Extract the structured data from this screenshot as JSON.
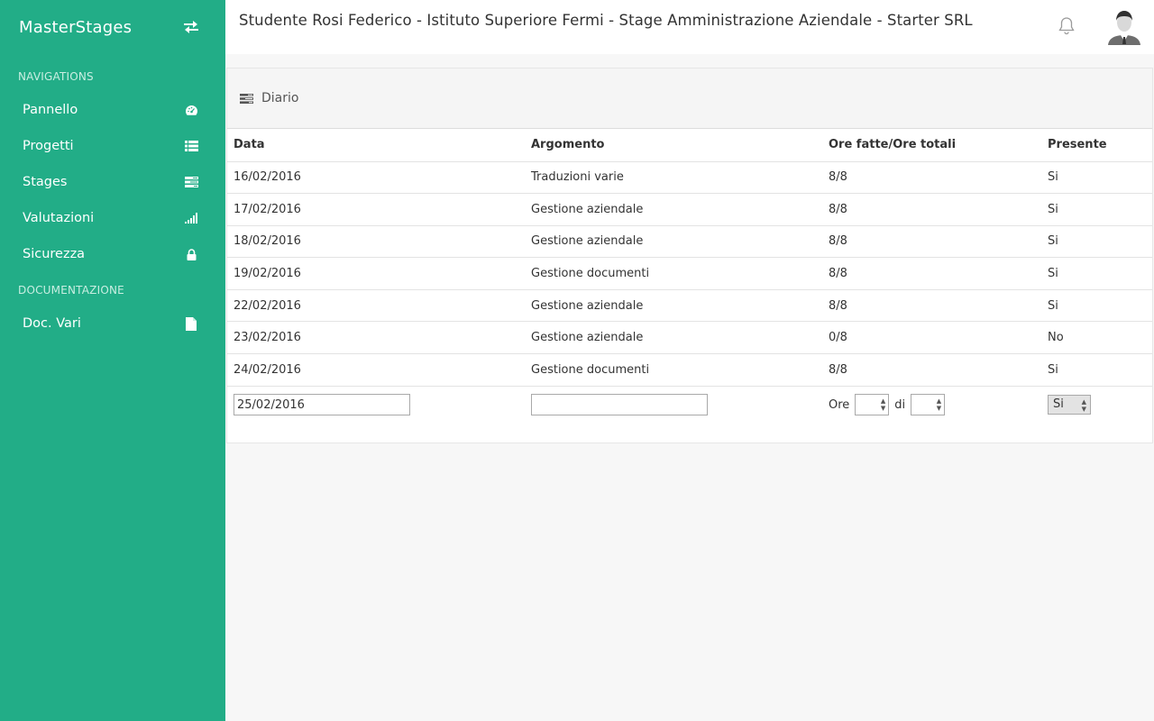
{
  "brand": {
    "name": "MasterStages",
    "toggle_icon": "arrows-exchange-icon"
  },
  "sidebar": {
    "sections": [
      {
        "title": "NAVIGATIONS",
        "items": [
          {
            "label": "Pannello",
            "icon": "dashboard-icon"
          },
          {
            "label": "Progetti",
            "icon": "list-icon"
          },
          {
            "label": "Stages",
            "icon": "tasks-icon"
          },
          {
            "label": "Valutazioni",
            "icon": "signal-icon"
          },
          {
            "label": "Sicurezza",
            "icon": "lock-icon"
          }
        ]
      },
      {
        "title": "DOCUMENTAZIONE",
        "items": [
          {
            "label": "Doc. Vari",
            "icon": "file-icon"
          }
        ]
      }
    ]
  },
  "header": {
    "title": "Studente Rosi Federico - Istituto Superiore Fermi - Stage Amministrazione Aziendale - Starter SRL",
    "bell_icon": "bell-icon",
    "avatar_icon": "user-avatar-icon"
  },
  "panel": {
    "title": "Diario"
  },
  "table": {
    "headers": [
      "Data",
      "Argomento",
      "Ore fatte/Ore totali",
      "Presente"
    ],
    "rows": [
      [
        "16/02/2016",
        "Traduzioni varie",
        "8/8",
        "Si"
      ],
      [
        "17/02/2016",
        "Gestione aziendale",
        "8/8",
        "Si"
      ],
      [
        "18/02/2016",
        "Gestione aziendale",
        "8/8",
        "Si"
      ],
      [
        "19/02/2016",
        "Gestione documenti",
        "8/8",
        "Si"
      ],
      [
        "22/02/2016",
        "Gestione aziendale",
        "8/8",
        "Si"
      ],
      [
        "23/02/2016",
        "Gestione aziendale",
        "0/8",
        "No"
      ],
      [
        "24/02/2016",
        "Gestione documenti",
        "8/8",
        "Si"
      ]
    ]
  },
  "new_entry": {
    "date_value": "25/02/2016",
    "argomento_value": "",
    "ore_label": "Ore",
    "di_label": "di",
    "presente_value": "Si"
  },
  "colors": {
    "sidebar_bg": "#22ad87",
    "page_bg": "#f7f7f7"
  }
}
